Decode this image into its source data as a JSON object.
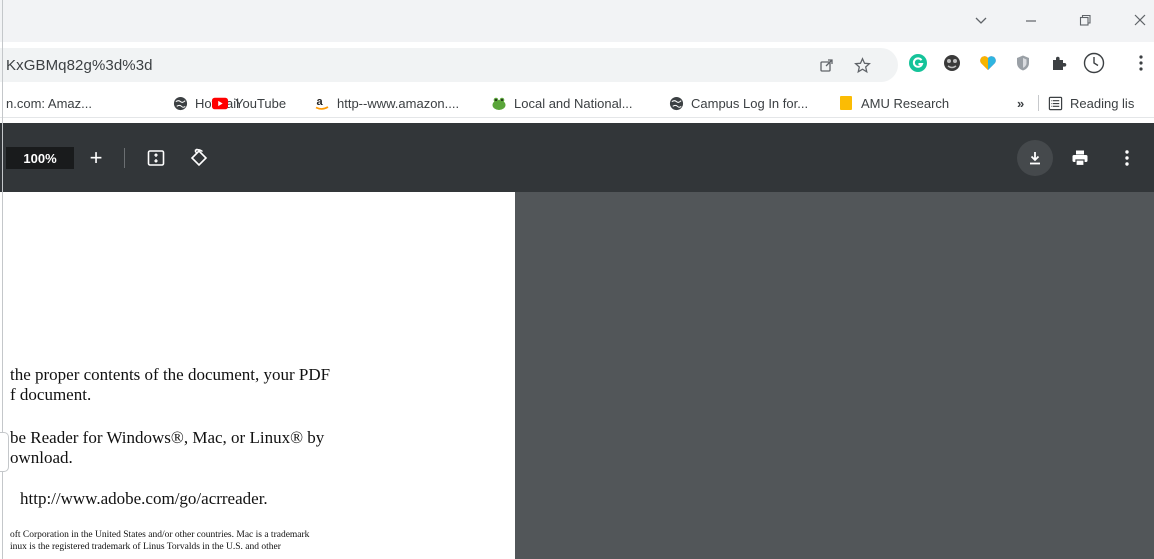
{
  "address_bar": {
    "url": "KxGBMq82g%3d%3d"
  },
  "bookmarks": [
    {
      "label": "n.com: Amaz...",
      "icon": "amazon-icon"
    },
    {
      "label": "Hotmail",
      "icon": "globe-icon"
    },
    {
      "label": "YouTube",
      "icon": "youtube-icon"
    },
    {
      "label": "http--www.amazon....",
      "icon": "amazon-icon"
    },
    {
      "label": "Local and National...",
      "icon": "frog-icon"
    },
    {
      "label": "Campus Log In for...",
      "icon": "globe-icon"
    },
    {
      "label": "AMU Research",
      "icon": "folder-icon"
    }
  ],
  "bookmarks_overflow": "»",
  "reading_list": {
    "label": "Reading lis",
    "icon": "reading-list-icon"
  },
  "pdf_toolbar": {
    "zoom": "100%",
    "zoom_in": "+"
  },
  "pdf_page": {
    "lines": [
      "the proper contents of the document, your PDF",
      "f document.",
      "be Reader for Windows®, Mac, or Linux® by",
      "ownload.",
      "http://www.adobe.com/go/acrreader.",
      "oft Corporation in the United States and/or other countries. Mac is a trademark",
      "inux is the registered trademark of Linus Torvalds in the U.S. and other"
    ]
  },
  "colors": {
    "titlebar": "#f2f3f5",
    "omnibox": "#f1f3f4",
    "pdf_toolbar": "#323639",
    "viewer_background": "#525659",
    "page": "#ffffff"
  }
}
